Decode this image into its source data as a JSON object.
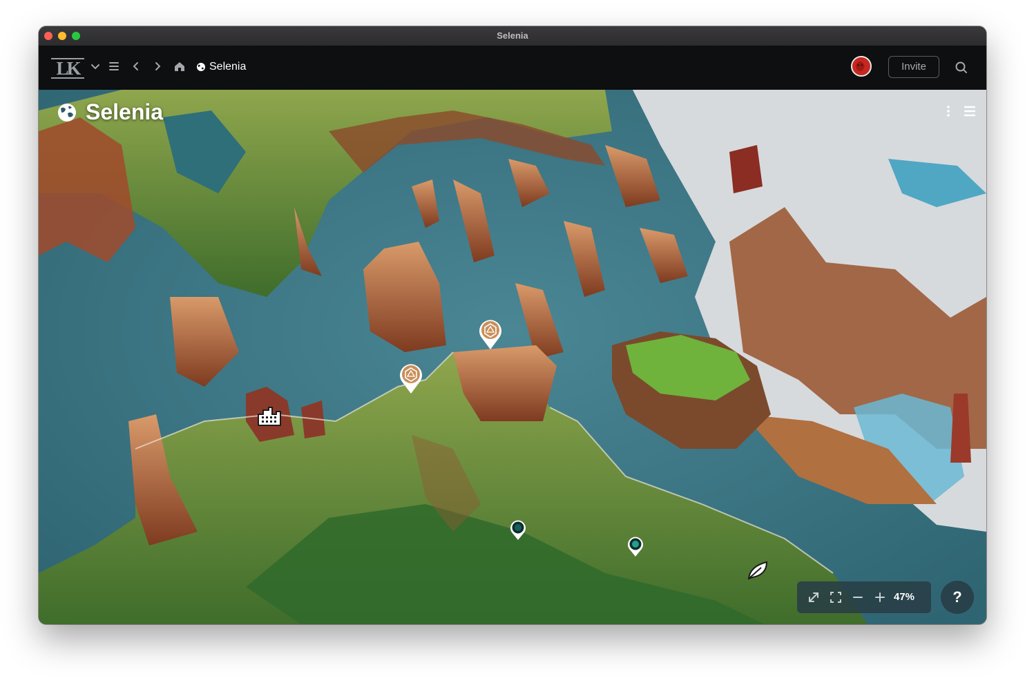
{
  "window": {
    "title": "Selenia"
  },
  "appbar": {
    "logo_text": "LK",
    "breadcrumb": "Selenia",
    "invite_label": "Invite",
    "icons": [
      "chevron-down-icon",
      "menu-icon",
      "back-icon",
      "forward-icon",
      "home-icon",
      "globe-icon",
      "search-icon"
    ]
  },
  "map": {
    "title": "Selenia",
    "zoom_label": "47%",
    "help_label": "?",
    "pins": [
      {
        "name": "pin-d20-north",
        "kind": "d20",
        "color": "#c98f5a"
      },
      {
        "name": "pin-d20-west",
        "kind": "d20",
        "color": "#c98f5a"
      },
      {
        "name": "pin-city",
        "kind": "city",
        "color": "#ffffff"
      },
      {
        "name": "pin-teal-dark",
        "kind": "marker",
        "color": "#175f58"
      },
      {
        "name": "pin-teal-light",
        "kind": "marker",
        "color": "#23a08c"
      },
      {
        "name": "pin-leaf",
        "kind": "leaf",
        "color": "#ffffff"
      }
    ]
  },
  "colors": {
    "accent": "#2f8fd8",
    "sea": "#3d7683",
    "forest": "#4c7b35",
    "rock": "#a85b35",
    "snow": "#d9dde0"
  }
}
